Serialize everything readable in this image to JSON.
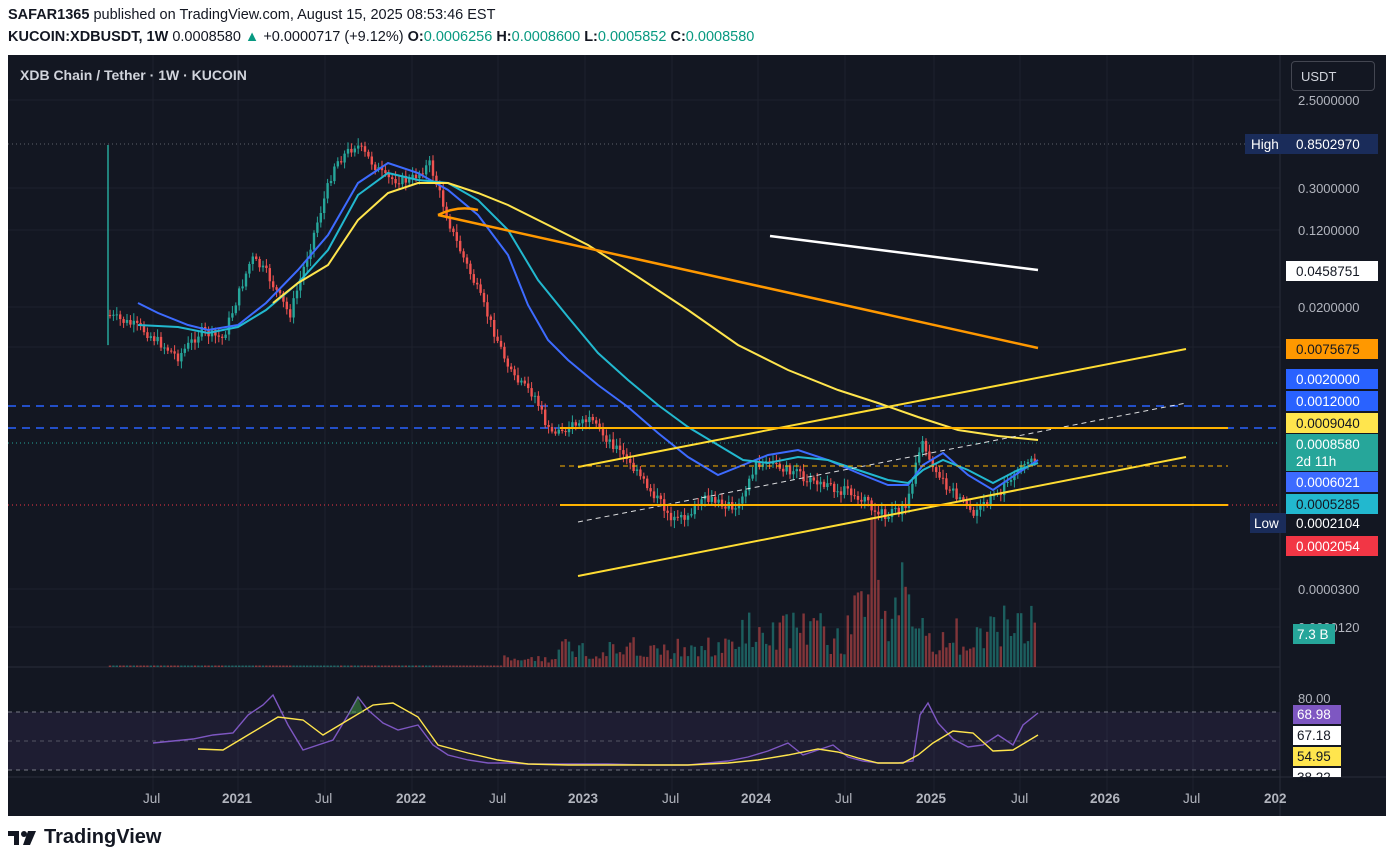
{
  "header": {
    "publisher": "SAFAR1365",
    "published_text": "published on TradingView.com, August 15, 2025 08:53:46 EST",
    "symbol": "KUCOIN:XDBUSDT, 1W",
    "last_price": "0.0008580",
    "change_arrow": "▲",
    "change": "+0.0000717 (+9.12%)",
    "o_label": "O:",
    "o_value": "0.0006256",
    "h_label": "H:",
    "h_value": "0.0008600",
    "l_label": "L:",
    "l_value": "0.0005852",
    "c_label": "C:",
    "c_value": "0.0008580"
  },
  "chart_title": "XDB Chain / Tether · 1W · KUCOIN",
  "currency_button": "USDT",
  "footer_brand": "TradingView",
  "colors": {
    "background": "#131722",
    "up": "#26a69a",
    "down": "#ef5350",
    "ema_fast": "#3d6bff",
    "ema_slow": "#22b8cf",
    "ma_long": "#ffe54d",
    "trend_orange": "#ff9800",
    "channel": "#ffdd33",
    "level_blue": "#2962ff",
    "rsi": "#7e57c2"
  },
  "chart_data": {
    "type": "line",
    "scale": "log",
    "timeframe": "1W",
    "x_tick_labels": [
      "Jul",
      "2021",
      "Jul",
      "2022",
      "Jul",
      "2023",
      "Jul",
      "2024",
      "Jul",
      "2025",
      "Jul",
      "2026",
      "Jul",
      "202"
    ],
    "y_tick_labels": [
      "2.5000000",
      "0.3000000",
      "0.1200000",
      "0.0200000",
      "0.0000300",
      "0.0000120"
    ],
    "markers": {
      "high_label": "High",
      "high_value": "0.8502970",
      "low_label": "Low",
      "low_value": "0.0002104"
    },
    "price_labels": [
      {
        "value": "0.0458751",
        "role": "white trend line",
        "bg": "#ffffff",
        "fg": "#131722"
      },
      {
        "value": "0.0075675",
        "role": "orange trend line",
        "bg": "#ff9800",
        "fg": "#131722"
      },
      {
        "value": "0.0020000",
        "role": "blue dashed level",
        "bg": "#2962ff",
        "fg": "#ffffff"
      },
      {
        "value": "0.0012000",
        "role": "blue dashed level",
        "bg": "#2962ff",
        "fg": "#ffffff"
      },
      {
        "value": "0.0009040",
        "role": "yellow long MA",
        "bg": "#ffe54d",
        "fg": "#131722"
      },
      {
        "value": "0.0008580",
        "role": "last price",
        "bg": "#26a69a",
        "fg": "#ffffff"
      },
      {
        "value": "0.0006021",
        "role": "fast EMA",
        "bg": "#3d6bff",
        "fg": "#ffffff"
      },
      {
        "value": "0.0005285",
        "role": "slow EMA",
        "bg": "#22b8cf",
        "fg": "#131722"
      },
      {
        "value": "0.0002054",
        "role": "red dotted level",
        "bg": "#f23645",
        "fg": "#ffffff"
      }
    ],
    "countdown": "2d 11h",
    "volume_label": "7.3 B",
    "rsi": {
      "axis_labels": [
        "80.00",
        "38.22"
      ],
      "value_labels": [
        "68.98",
        "67.18",
        "54.95"
      ]
    },
    "price_series": [
      [
        "2020-05-25",
        0.02
      ],
      [
        "2020-08-01",
        0.015
      ],
      [
        "2020-10-15",
        0.008
      ],
      [
        "2020-12-01",
        0.014
      ],
      [
        "2021-01-15",
        0.012
      ],
      [
        "2021-03-15",
        0.07
      ],
      [
        "2021-04-15",
        0.05
      ],
      [
        "2021-06-01",
        0.02
      ],
      [
        "2021-08-01",
        0.18
      ],
      [
        "2021-09-01",
        0.55
      ],
      [
        "2021-10-15",
        0.850297
      ],
      [
        "2021-12-15",
        0.4
      ],
      [
        "2022-02-01",
        0.38
      ],
      [
        "2022-03-15",
        0.55
      ],
      [
        "2022-05-01",
        0.12
      ],
      [
        "2022-06-15",
        0.04
      ],
      [
        "2022-09-01",
        0.005
      ],
      [
        "2022-10-15",
        0.0035
      ],
      [
        "2022-11-15",
        0.0015
      ],
      [
        "2023-02-01",
        0.002
      ],
      [
        "2023-04-01",
        0.0011
      ],
      [
        "2023-06-15",
        0.0004
      ],
      [
        "2023-08-01",
        0.0002104
      ],
      [
        "2023-10-01",
        0.00035
      ],
      [
        "2023-12-01",
        0.0003
      ],
      [
        "2024-01-15",
        0.0008
      ],
      [
        "2024-03-15",
        0.0007
      ],
      [
        "2024-05-15",
        0.0005
      ],
      [
        "2024-08-01",
        0.0004
      ],
      [
        "2024-10-01",
        0.00025
      ],
      [
        "2024-11-15",
        0.0003
      ],
      [
        "2024-12-15",
        0.0012
      ],
      [
        "2025-02-01",
        0.0005
      ],
      [
        "2025-04-01",
        0.00025
      ],
      [
        "2025-06-01",
        0.00045
      ],
      [
        "2025-07-15",
        0.00075
      ],
      [
        "2025-08-11",
        0.000858
      ]
    ]
  }
}
